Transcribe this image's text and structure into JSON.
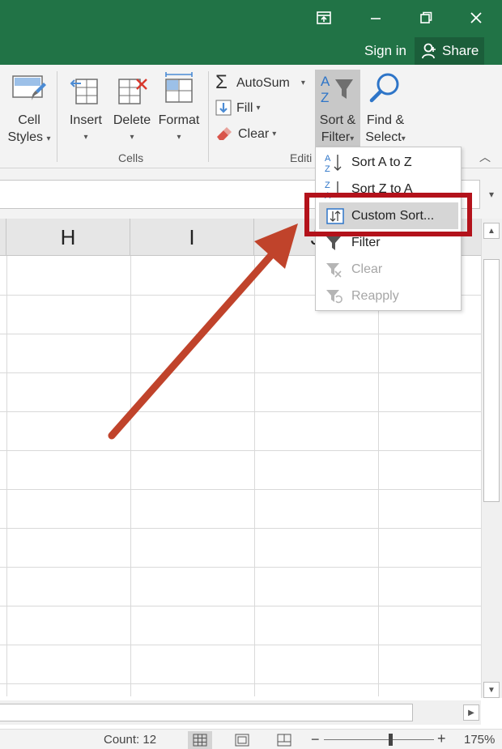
{
  "titlebar": {
    "signin": "Sign in",
    "share": "Share",
    "color": "#217346"
  },
  "ribbon": {
    "cell_styles": [
      "Cell",
      "Styles"
    ],
    "insert": "Insert",
    "delete": "Delete",
    "format": "Format",
    "cells_group": "Cells",
    "autosum": "AutoSum",
    "fill": "Fill",
    "clear": "Clear",
    "editing_group": "Editi",
    "sort_filter": [
      "Sort &",
      "Filter"
    ],
    "find_select": [
      "Find &",
      "Select"
    ]
  },
  "grid": {
    "columns": [
      "H",
      "I",
      "J"
    ]
  },
  "menu": {
    "items": [
      {
        "label": "Sort A to Z",
        "icon": "sort-a-to-z-icon",
        "enabled": true
      },
      {
        "label": "Sort Z to A",
        "icon": "sort-z-to-a-icon",
        "enabled": true
      },
      {
        "label": "Custom Sort...",
        "icon": "custom-sort-icon",
        "enabled": true,
        "highlighted": true
      },
      {
        "label": "Filter",
        "icon": "filter-icon",
        "enabled": true
      },
      {
        "label": "Clear",
        "icon": "clear-filter-icon",
        "enabled": false
      },
      {
        "label": "Reapply",
        "icon": "reapply-icon",
        "enabled": false
      }
    ]
  },
  "status": {
    "count": "Count: 12",
    "zoom": "175%"
  },
  "annotation": {
    "highlight_color": "#b3121b",
    "arrow_color": "#c0432b"
  }
}
